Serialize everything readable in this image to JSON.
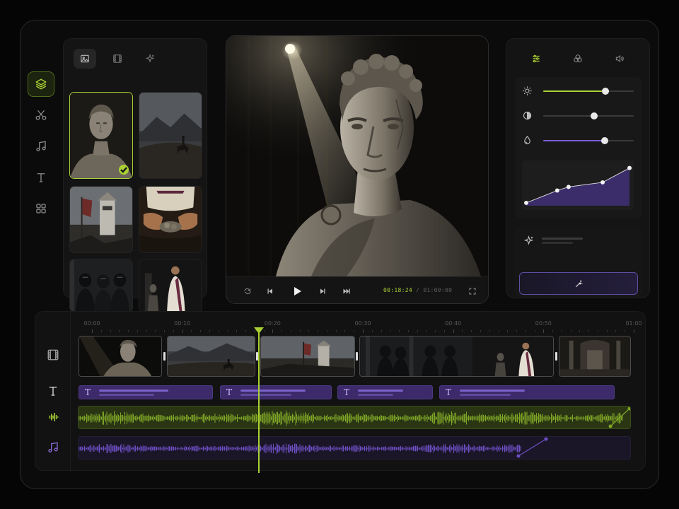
{
  "theme": {
    "accent": "#a9d134",
    "purple": "#7a5fd6",
    "panel": "#141414"
  },
  "rail": {
    "items": [
      {
        "icon": "layers-icon",
        "active": true
      },
      {
        "icon": "scissors-icon",
        "active": false
      },
      {
        "icon": "music-icon",
        "active": false
      },
      {
        "icon": "text-icon",
        "active": false
      },
      {
        "icon": "grid-icon",
        "active": false
      }
    ]
  },
  "media": {
    "tabs": [
      {
        "icon": "image-icon",
        "active": true
      },
      {
        "icon": "film-icon",
        "active": false
      },
      {
        "icon": "sparkle-icon",
        "active": false
      }
    ],
    "thumbnails": [
      {
        "subject": "marble-bust",
        "selected": true
      },
      {
        "subject": "horse-rider",
        "selected": false
      },
      {
        "subject": "watchtower",
        "selected": false
      },
      {
        "subject": "coins-in-hands",
        "selected": false
      },
      {
        "subject": "soldiers",
        "selected": false
      },
      {
        "subject": "senator",
        "selected": false
      }
    ]
  },
  "preview": {
    "current_time": "00:18:24",
    "separator": "/",
    "total_time": "01:00:00",
    "controls": [
      "loop-icon",
      "skip-back-icon",
      "play-icon",
      "step-forward-icon",
      "skip-forward-icon",
      "fullscreen-icon"
    ]
  },
  "adjust": {
    "tabs": [
      {
        "icon": "sliders-icon",
        "active": true
      },
      {
        "icon": "color-circles-icon",
        "active": false
      },
      {
        "icon": "speaker-icon",
        "active": false
      }
    ],
    "sliders": [
      {
        "icon": "brightness-icon",
        "value": 0.69,
        "fill": "#a9d134"
      },
      {
        "icon": "contrast-icon",
        "value": 0.56,
        "fill": "#3a3a3a"
      },
      {
        "icon": "saturation-icon",
        "value": 0.68,
        "fill": "#7a5fd6"
      }
    ],
    "curve_points": [
      [
        0,
        0.07
      ],
      [
        0.3,
        0.37
      ],
      [
        0.41,
        0.46
      ],
      [
        0.74,
        0.57
      ],
      [
        1,
        0.92
      ]
    ]
  },
  "timeline": {
    "ticks": [
      "00:00",
      "00:10",
      "00:20",
      "00:30",
      "00:40",
      "00:50",
      "01:00"
    ],
    "tracks": [
      "film-icon",
      "text-icon",
      "waveform-icon",
      "music-icon"
    ]
  }
}
